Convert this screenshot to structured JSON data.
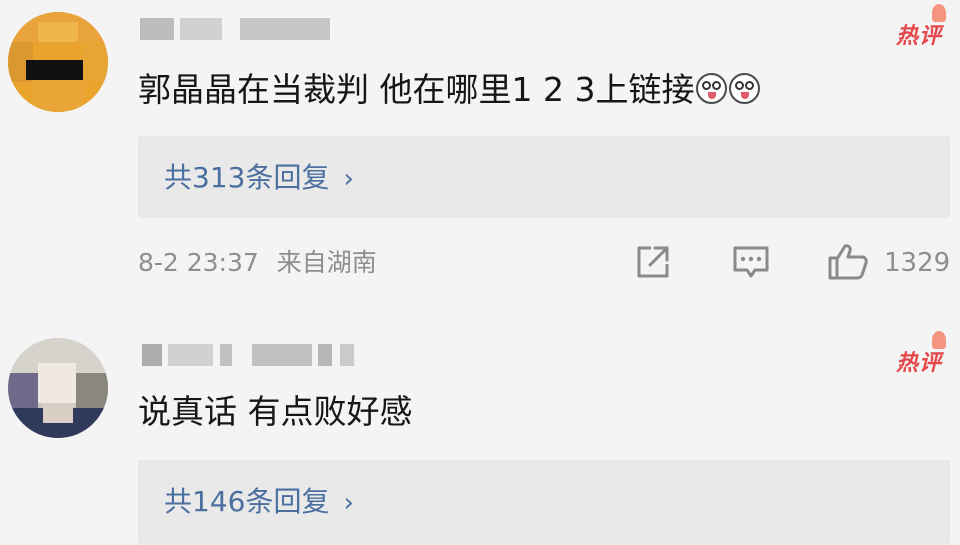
{
  "comments": [
    {
      "username": "",
      "hot_label": "热评",
      "text": "郭晶晶在当裁判 他在哪里1 2 3上链接",
      "emojis": [
        "laughing-tongue-emoji",
        "laughing-tongue-emoji"
      ],
      "replies_label": "共313条回复",
      "timestamp": "8-2 23:37",
      "location": "来自湖南",
      "like_count": "1329",
      "icons": {
        "share": "share-external-icon",
        "comment": "comment-bubble-icon",
        "like": "thumbs-up-icon"
      }
    },
    {
      "username": "",
      "hot_label": "热评",
      "text": "说真话 有点败好感",
      "replies_label": "共146条回复"
    }
  ],
  "colors": {
    "background": "#f4f4f4",
    "reply_box": "#e9e9e9",
    "link": "#4b6f9e",
    "hot_badge": "#e4484b",
    "meta": "#8e8e8e"
  }
}
